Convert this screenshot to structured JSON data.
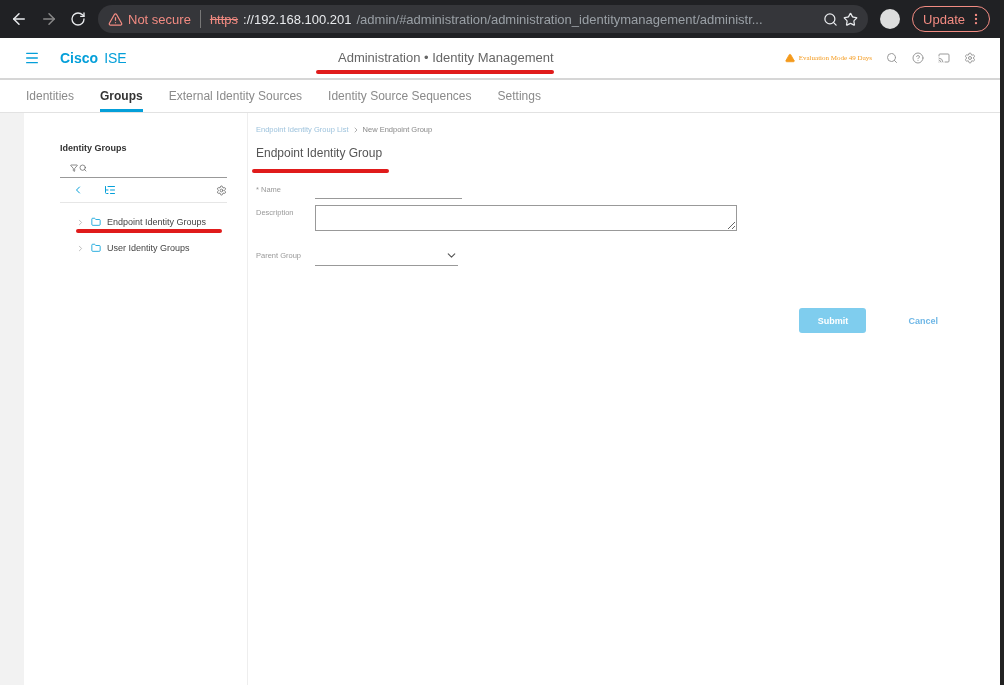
{
  "browser": {
    "security": "Not secure",
    "url_scheme": "https",
    "url_host": "://192.168.100.201",
    "url_path": "/admin/#administration/administration_identitymanagement/administr...",
    "update": "Update"
  },
  "header": {
    "brand_bold": "Cisco",
    "brand_light": "ISE",
    "title": "Administration • Identity Management",
    "evaluation": "Evaluation Mode 49 Days"
  },
  "tabs": [
    {
      "label": "Identities",
      "selected": false
    },
    {
      "label": "Groups",
      "selected": true
    },
    {
      "label": "External Identity Sources",
      "selected": false
    },
    {
      "label": "Identity Source Sequences",
      "selected": false
    },
    {
      "label": "Settings",
      "selected": false
    }
  ],
  "sidebar": {
    "title": "Identity Groups",
    "tree": [
      {
        "label": "Endpoint Identity Groups",
        "expanded": false
      },
      {
        "label": "User Identity Groups",
        "expanded": false
      }
    ]
  },
  "breadcrumb": {
    "link": "Endpoint Identity Group List",
    "current": "New Endpoint Group"
  },
  "form": {
    "title": "Endpoint Identity Group",
    "fields": [
      {
        "label": "* Name",
        "kind": "input"
      },
      {
        "label": "Description",
        "kind": "textarea"
      },
      {
        "label": "Parent Group",
        "kind": "select"
      }
    ],
    "submit": "Submit",
    "cancel": "Cancel"
  }
}
